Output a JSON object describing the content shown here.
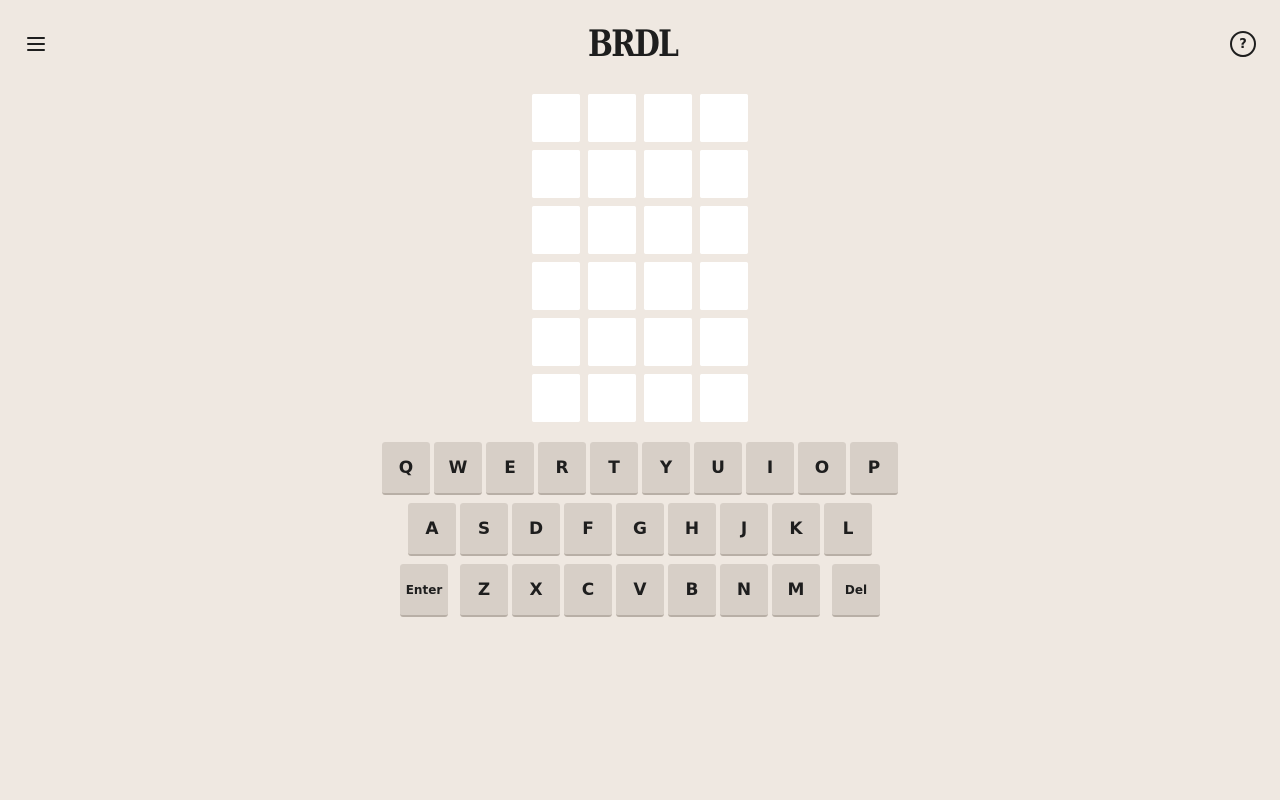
{
  "header": {
    "menu_icon": "hamburger-menu-icon",
    "logo_text": "BRDL",
    "logo_icon": "woodpecker-icon",
    "help_label": "?"
  },
  "board": {
    "rows": 6,
    "cols": 4
  },
  "keyboard": {
    "row1": [
      "Q",
      "W",
      "E",
      "R",
      "T",
      "Y",
      "U",
      "I",
      "O",
      "P"
    ],
    "row2": [
      "A",
      "S",
      "D",
      "F",
      "G",
      "H",
      "J",
      "K",
      "L"
    ],
    "row3": [
      "Z",
      "X",
      "C",
      "V",
      "B",
      "N",
      "M"
    ],
    "enter_label": "Enter",
    "delete_label": "Del"
  },
  "colors": {
    "background": "#efe8e1",
    "tile": "#ffffff",
    "key": "#d7cfc7",
    "text": "#1e1e1e"
  }
}
